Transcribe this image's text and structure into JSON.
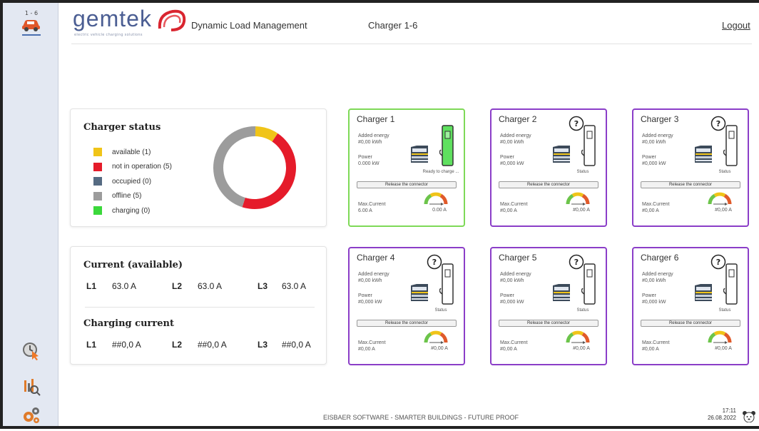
{
  "sidebar": {
    "top_tag": "1 - 6",
    "items": [
      {
        "icon": "car-charger-icon"
      },
      {
        "icon": "clock-cursor-icon"
      },
      {
        "icon": "report-magnifier-icon"
      },
      {
        "icon": "gears-icon"
      }
    ]
  },
  "header": {
    "brand": "gemtek",
    "tagline": "electric vehicle charging solutions",
    "app_title": "Dynamic Load Management",
    "page_title": "Charger 1-6",
    "logout": "Logout"
  },
  "status": {
    "title": "Charger status",
    "legend": [
      {
        "label": "available (1)",
        "color": "#f0c418",
        "count": 1
      },
      {
        "label": "not in operation (5)",
        "color": "#e51b2a",
        "count": 5
      },
      {
        "label": "occupied (0)",
        "color": "#566b82",
        "count": 0
      },
      {
        "label": "offline (5)",
        "color": "#9c9c9c",
        "count": 5
      },
      {
        "label": "charging (0)",
        "color": "#3bd83b",
        "count": 0
      }
    ]
  },
  "current": {
    "title": "Current (available)",
    "l1_label": "L1",
    "l1_value": "63.0 A",
    "l2_label": "L2",
    "l2_value": "63.0 A",
    "l3_label": "L3",
    "l3_value": "63.0 A"
  },
  "charging": {
    "title": "Charging current",
    "l1_label": "L1",
    "l1_value": "##0,0 A",
    "l2_label": "L2",
    "l2_value": "##0,0 A",
    "l3_label": "L3",
    "l3_value": "##0,0 A"
  },
  "chargers": [
    {
      "title": "Charger 1",
      "energy_label": "Added energy",
      "energy_value": "#0,00 kWh",
      "power_label": "Power",
      "power_value": "0.000 kW",
      "status": "Ready to charge ...",
      "release": "Release the connector",
      "max_label": "Max.Current",
      "max_value": "6.00 A",
      "amp_value": "0.00 A",
      "active": true
    },
    {
      "title": "Charger 2",
      "energy_label": "Added energy",
      "energy_value": "#0,00 kWh",
      "power_label": "Power",
      "power_value": "#0,000 kW",
      "status": "Status",
      "release": "Release the connector",
      "max_label": "Max.Current",
      "max_value": "#0,00 A",
      "amp_value": "#0,00 A",
      "active": false
    },
    {
      "title": "Charger 3",
      "energy_label": "Added energy",
      "energy_value": "#0,00 kWh",
      "power_label": "Power",
      "power_value": "#0,000 kW",
      "status": "Status",
      "release": "Release the connector",
      "max_label": "Max.Current",
      "max_value": "#0,00 A",
      "amp_value": "#0,00 A",
      "active": false
    },
    {
      "title": "Charger 4",
      "energy_label": "Added energy",
      "energy_value": "#0,00 kWh",
      "power_label": "Power",
      "power_value": "#0,000 kW",
      "status": "Status",
      "release": "Release the connector",
      "max_label": "Max.Current",
      "max_value": "#0,00 A",
      "amp_value": "#0,00 A",
      "active": false
    },
    {
      "title": "Charger 5",
      "energy_label": "Added energy",
      "energy_value": "#0,00 kWh",
      "power_label": "Power",
      "power_value": "#0,000 kW",
      "status": "Status",
      "release": "Release the connector",
      "max_label": "Max.Current",
      "max_value": "#0,00 A",
      "amp_value": "#0,00 A",
      "active": false
    },
    {
      "title": "Charger 6",
      "energy_label": "Added energy",
      "energy_value": "#0,00 kWh",
      "power_label": "Power",
      "power_value": "#0,000 kW",
      "status": "Status",
      "release": "Release the connector",
      "max_label": "Max.Current",
      "max_value": "#0,00 A",
      "amp_value": "#0,00 A",
      "active": false
    }
  ],
  "footer": {
    "text": "EISBAER SOFTWARE - SMARTER BUILDINGS - FUTURE PROOF",
    "time": "17:11",
    "date": "26.08.2022"
  },
  "colors": {
    "accent": "#8b3ec8",
    "active_border": "#7ed957",
    "brand": "#4b5e93",
    "logo_red": "#d9252f"
  }
}
